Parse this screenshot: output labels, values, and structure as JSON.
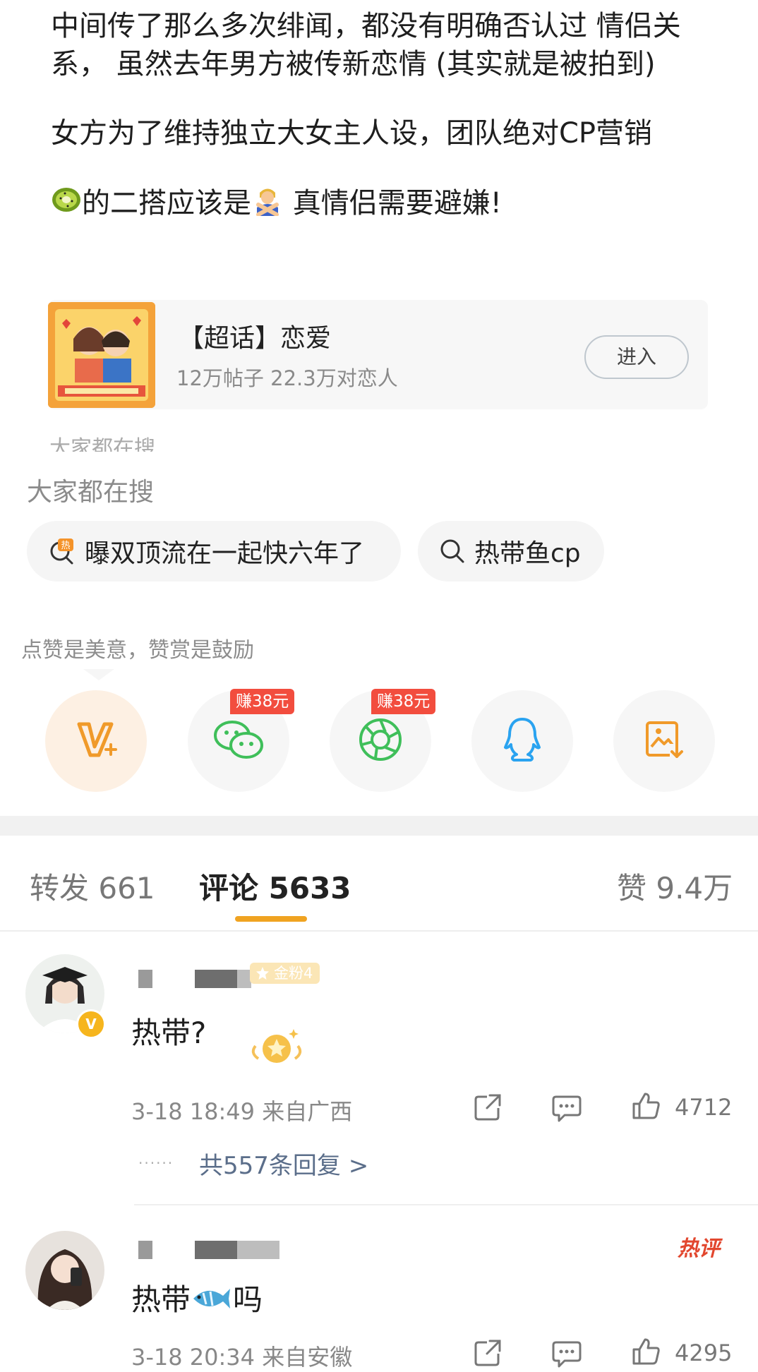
{
  "post": {
    "paragraphs": [
      "中间传了那么多次绯闻，都没有明确否认过  情侣关系， 虽然去年男方被传新恋情 (其实就是被拍到)",
      "女方为了维持独立大女主人设，团队绝对CP营销"
    ],
    "last_line_text_a": "的二搭应该是",
    "last_line_text_b": "  真情侣需要避嫌!",
    "emoji_1": "kiwi-emoji",
    "emoji_2": "person-gesturing-no-emoji"
  },
  "topic_card": {
    "title": "【超话】恋爱",
    "subtitle": "12万帖子 22.3万对恋人",
    "enter_label": "进入"
  },
  "cut_text": "大家都在搜",
  "search": {
    "title": "大家都在搜",
    "chips": [
      {
        "label": "曝双顶流在一起快六年了",
        "icon": "hot-search-icon"
      },
      {
        "label": "热带鱼cp",
        "icon": "search-icon"
      }
    ]
  },
  "share": {
    "caption": "点赞是美意，赞赏是鼓励",
    "earn_badge_1": "赚38元",
    "earn_badge_2": "赚38元",
    "items": [
      "v-plus-icon",
      "wechat-icon",
      "moments-icon",
      "qq-icon",
      "save-image-icon"
    ]
  },
  "tabs": {
    "repost": "转发 661",
    "comments": "评论 5633",
    "likes": "赞 9.4万"
  },
  "comments": [
    {
      "fan_badge": "金粉4",
      "text": "热带?",
      "meta": "3-18 18:49  来自广西",
      "likes": "4712",
      "replies": "共557条回复 >"
    },
    {
      "hot_tag": "热评",
      "text_a": "热带",
      "text_b": "吗",
      "emoji": "fish-emoji",
      "meta": "3-18 20:34  来自安徽",
      "likes": "4295"
    }
  ],
  "colors": {
    "accent": "#f0a321",
    "earn_badge": "#f24d3e",
    "hot_tag": "#e2472e",
    "wechat": "#3fbf5a",
    "qq": "#2aa3f0"
  }
}
